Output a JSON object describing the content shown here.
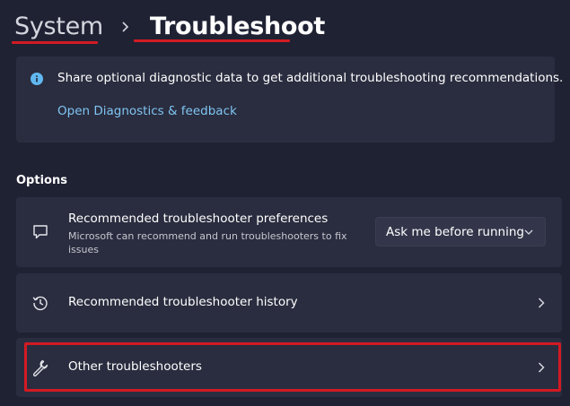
{
  "breadcrumb": {
    "parent": "System",
    "current": "Troubleshoot"
  },
  "info": {
    "icon": "info-icon",
    "message": "Share optional diagnostic data to get additional troubleshooting recommendations.",
    "link": "Open Diagnostics & feedback"
  },
  "options": {
    "title": "Options",
    "preferences": {
      "icon": "chat-icon",
      "title": "Recommended troubleshooter preferences",
      "description": "Microsoft can recommend and run troubleshooters to fix issues",
      "dropdown_value": "Ask me before running"
    },
    "history": {
      "icon": "history-icon",
      "title": "Recommended troubleshooter history"
    },
    "other": {
      "icon": "wrench-icon",
      "title": "Other troubleshooters"
    }
  },
  "colors": {
    "background": "#1f2233",
    "card": "#2a2d3f",
    "accent_link": "#7fc4f2",
    "annotation_red": "#d21a23"
  }
}
